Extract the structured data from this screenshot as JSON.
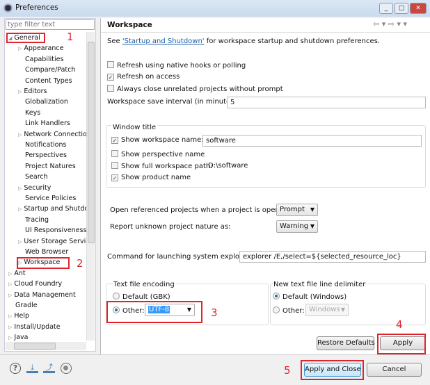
{
  "window": {
    "title": "Preferences",
    "controls": [
      "_",
      "□",
      "✕"
    ]
  },
  "filter": {
    "placeholder": "type filter text"
  },
  "tree": [
    {
      "label": "General",
      "level": 0,
      "arrow": "◢"
    },
    {
      "label": "Appearance",
      "level": 1,
      "arrow": "▷"
    },
    {
      "label": "Capabilities",
      "level": 1,
      "arrow": ""
    },
    {
      "label": "Compare/Patch",
      "level": 1,
      "arrow": ""
    },
    {
      "label": "Content Types",
      "level": 1,
      "arrow": ""
    },
    {
      "label": "Editors",
      "level": 1,
      "arrow": "▷"
    },
    {
      "label": "Globalization",
      "level": 1,
      "arrow": ""
    },
    {
      "label": "Keys",
      "level": 1,
      "arrow": ""
    },
    {
      "label": "Link Handlers",
      "level": 1,
      "arrow": ""
    },
    {
      "label": "Network Connectio",
      "level": 1,
      "arrow": "▷"
    },
    {
      "label": "Notifications",
      "level": 1,
      "arrow": ""
    },
    {
      "label": "Perspectives",
      "level": 1,
      "arrow": ""
    },
    {
      "label": "Project Natures",
      "level": 1,
      "arrow": ""
    },
    {
      "label": "Search",
      "level": 1,
      "arrow": ""
    },
    {
      "label": "Security",
      "level": 1,
      "arrow": "▷"
    },
    {
      "label": "Service Policies",
      "level": 1,
      "arrow": ""
    },
    {
      "label": "Startup and Shutdo",
      "level": 1,
      "arrow": "▷"
    },
    {
      "label": "Tracing",
      "level": 1,
      "arrow": ""
    },
    {
      "label": "UI Responsiveness",
      "level": 1,
      "arrow": ""
    },
    {
      "label": "User Storage Servic",
      "level": 1,
      "arrow": "▷"
    },
    {
      "label": "Web Browser",
      "level": 1,
      "arrow": ""
    },
    {
      "label": "Workspace",
      "level": 1,
      "arrow": "▷"
    },
    {
      "label": "Ant",
      "level": 0,
      "arrow": "▷"
    },
    {
      "label": "Cloud Foundry",
      "level": 0,
      "arrow": "▷"
    },
    {
      "label": "Data Management",
      "level": 0,
      "arrow": "▷"
    },
    {
      "label": "Gradle",
      "level": 0,
      "arrow": ""
    },
    {
      "label": "Help",
      "level": 0,
      "arrow": "▷"
    },
    {
      "label": "Install/Update",
      "level": 0,
      "arrow": "▷"
    },
    {
      "label": "Java",
      "level": 0,
      "arrow": "▷"
    }
  ],
  "page": {
    "title": "Workspace",
    "see_prefix": "See ",
    "see_link": "'Startup and Shutdown'",
    "see_suffix": " for workspace startup and shutdown preferences.",
    "checks": [
      {
        "label": "Refresh using native hooks or polling",
        "checked": false
      },
      {
        "label": "Refresh on access",
        "checked": true
      },
      {
        "label": "Always close unrelated projects without prompt",
        "checked": false
      }
    ],
    "interval_label": "Workspace save interval (in minutes):",
    "interval_value": "5",
    "window_title": {
      "label": "Window title",
      "show_ws_name": "Show workspace name:",
      "ws_name_value": "software",
      "show_perspective": "Show perspective name",
      "show_full_path": "Show full workspace path:",
      "full_path_value": "D:\\software",
      "show_product": "Show product name"
    },
    "open_ref_label": "Open referenced projects when a project is opened:",
    "open_ref_value": "Prompt",
    "unknown_label": "Report unknown project nature as:",
    "unknown_value": "Warning",
    "command_label": "Command for launching system explorer:",
    "command_value": "explorer /E,/select=${selected_resource_loc}",
    "encoding": {
      "label": "Text file encoding",
      "default": "Default (GBK)",
      "other": "Other:",
      "value": "UTF-8",
      "selected": "other"
    },
    "delimiter": {
      "label": "New text file line delimiter",
      "default": "Default (Windows)",
      "other": "Other:",
      "value": "Windows",
      "selected": "default"
    },
    "restore": "Restore Defaults",
    "apply": "Apply"
  },
  "footer": {
    "apply_close": "Apply and Close",
    "cancel": "Cancel"
  },
  "annotations": [
    "1",
    "2",
    "3",
    "4",
    "5"
  ],
  "colors": {
    "annotation": "#e0242c",
    "link": "#1a5fa8",
    "selection": "#3399ff"
  }
}
